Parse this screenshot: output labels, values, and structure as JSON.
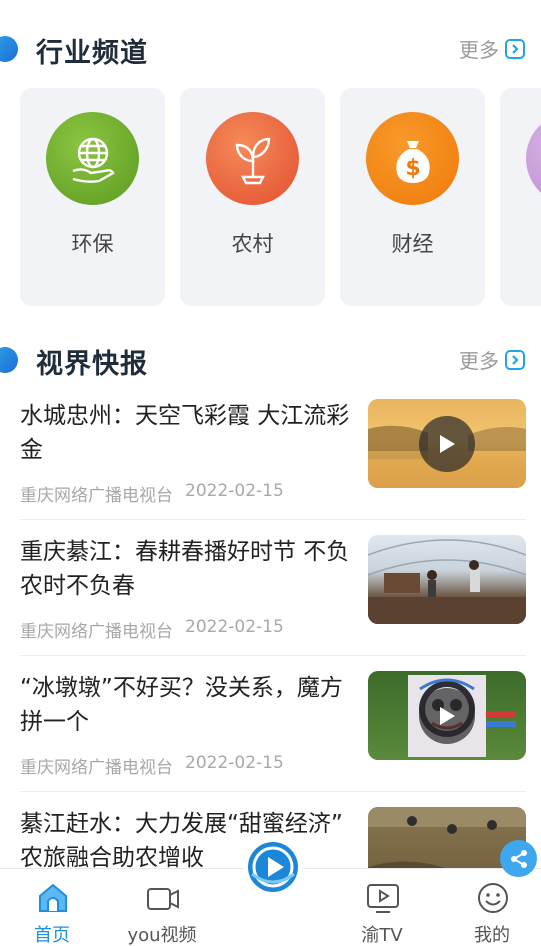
{
  "sections": {
    "channels": {
      "title": "行业频道",
      "more": "更多"
    },
    "news": {
      "title": "视界快报",
      "more": "更多"
    }
  },
  "channels": [
    {
      "label": "环保",
      "icon": "globe-hand-icon",
      "color": "#6eaa2a"
    },
    {
      "label": "农村",
      "icon": "sprout-icon",
      "color": "#ee6a3c"
    },
    {
      "label": "财经",
      "icon": "money-bag-icon",
      "color": "#f07f12"
    },
    {
      "label": "",
      "icon": "partial-channel-icon",
      "color": "#c7a3d8"
    }
  ],
  "news": [
    {
      "title": "水城忠州：天空飞彩霞 大江流彩金",
      "source": "重庆网络广播电视台",
      "date": "2022-02-15",
      "has_play": true
    },
    {
      "title": "重庆綦江：春耕春播好时节 不负农时不负春",
      "source": "重庆网络广播电视台",
      "date": "2022-02-15",
      "has_play": false
    },
    {
      "title": "“冰墩墩”不好买？没关系，魔方拼一个",
      "source": "重庆网络广播电视台",
      "date": "2022-02-15",
      "has_play": true
    },
    {
      "title": "綦江赶水：大力发展“甜蜜经济” 农旅融合助农增收",
      "source": "",
      "date": "",
      "has_play": false
    }
  ],
  "tabbar": {
    "tabs": [
      {
        "label": "首页",
        "icon": "home-icon",
        "active": true
      },
      {
        "label": "you视频",
        "icon": "video-camera-icon",
        "active": false
      },
      {
        "label": "渝TV",
        "icon": "tv-play-icon",
        "active": false
      },
      {
        "label": "我的",
        "icon": "smiley-icon",
        "active": false
      }
    ],
    "center_icon": "play-logo-icon"
  },
  "colors": {
    "accent": "#22a4e8",
    "active_tab": "#1f8fe0",
    "text": "#222222",
    "meta": "#a8a8a8"
  }
}
